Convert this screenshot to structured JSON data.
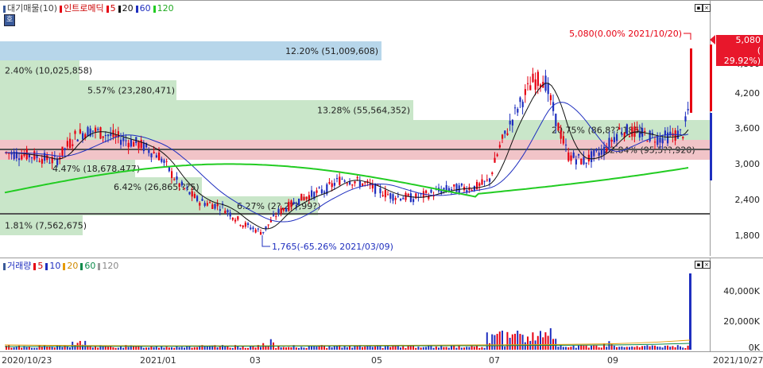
{
  "price_pane": {
    "legend": {
      "item_label": "대기매물(10)",
      "indicator_label": "인트로메딕",
      "ma_periods": [
        "5",
        "20",
        "60",
        "120"
      ],
      "ma_colors": [
        "#e60012",
        "#111111",
        "#1f2fbf",
        "#22cc22"
      ]
    },
    "side_tab": "호",
    "y_axis_labels": [
      "4,800",
      "4,200",
      "3,600",
      "3,000",
      "2,400",
      "1,800"
    ],
    "current_price": {
      "price": "5,080",
      "change": "( 29.92%)"
    },
    "high_marker": "5,080(0.00% 2021/10/20)",
    "low_marker": "1,765(-65.26% 2021/03/09)",
    "supply_bands": [
      {
        "label": "12.20% (51,009,608)",
        "percent": 12.2,
        "volume": 51009608,
        "color": "#b7d6ea"
      },
      {
        "label": "2.40% (10,025,858)",
        "percent": 2.4,
        "volume": 10025858,
        "color": "#c9e6c9"
      },
      {
        "label": "5.57% (23,280,471)",
        "percent": 5.57,
        "volume": 23280471,
        "color": "#c9e6c9"
      },
      {
        "label": "13.28% (55,564,352)",
        "percent": 13.28,
        "volume": 55564352,
        "color": "#c9e6c9"
      },
      {
        "label": "20.75% (86,8??,186)",
        "percent": 20.75,
        "volume": 86800186,
        "color": "#c9e6c9"
      },
      {
        "label": "22.84% (95,5??,920)",
        "percent": 22.84,
        "volume": 95500920,
        "color": "#f1c4c8"
      },
      {
        "label": "4.47% (18,678,477)",
        "percent": 4.47,
        "volume": 18678477,
        "color": "#c9e6c9"
      },
      {
        "label": "6.42% (26,865,??5)",
        "percent": 6.42,
        "volume": 26865005,
        "color": "#c9e6c9"
      },
      {
        "label": "6.27% (2?,2??,99?)",
        "percent": 6.27,
        "volume": 26200990,
        "color": "#c9e6c9"
      },
      {
        "label": "1.81% (7,562,675)",
        "percent": 1.81,
        "volume": 7562675,
        "color": "#c9e6c9"
      }
    ]
  },
  "volume_pane": {
    "legend": {
      "indicator_label": "거래량",
      "ma_periods": [
        "5",
        "10",
        "20",
        "60",
        "120"
      ],
      "ma_colors": [
        "#e60012",
        "#1f2fbf",
        "#e69a00",
        "#0b8a4a",
        "#9a9a9a"
      ]
    },
    "y_axis_labels": [
      "40,000K",
      "20,000K",
      "0K"
    ]
  },
  "x_axis_labels": [
    "2020/10/23",
    "2021/01",
    "03",
    "05",
    "07",
    "09",
    "2021/10/27"
  ],
  "colors": {
    "up": "#e60012",
    "down": "#1f2fbf",
    "band_line": "#555555"
  }
}
